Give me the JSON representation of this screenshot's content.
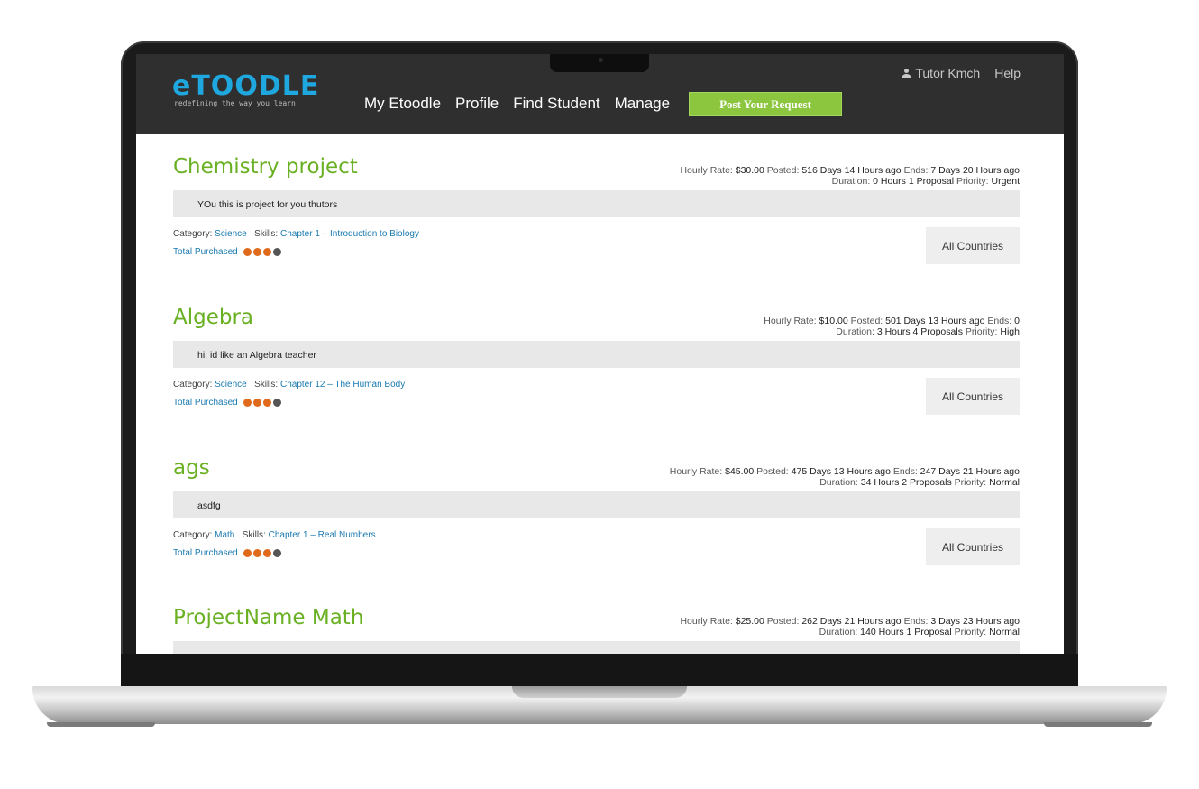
{
  "header": {
    "logo_text": "eTOODLE",
    "tagline": "redefining the way you learn",
    "nav": [
      "My Etoodle",
      "Profile",
      "Find Student",
      "Manage"
    ],
    "post_button": "Post Your Request",
    "user": "Tutor Kmch",
    "help": "Help"
  },
  "projects": [
    {
      "title": "Chemistry project",
      "rate_label": "Hourly Rate:",
      "rate": "$30.00",
      "posted_label": "Posted:",
      "posted": "516 Days 14 Hours ago",
      "ends_label": "Ends:",
      "ends": "7 Days 20 Hours ago",
      "duration_label": "Duration:",
      "duration": "0 Hours 1 Proposal",
      "priority_label": "Priority:",
      "priority": "Urgent",
      "description": "YOu this is project for you thutors",
      "category_label": "Category:",
      "category": "Science",
      "skills_label": "Skills:",
      "skills": "Chapter 1 – Introduction to Biology",
      "purchased_label": "Total Purchased",
      "countries": "All Countries"
    },
    {
      "title": "Algebra",
      "rate_label": "Hourly Rate:",
      "rate": "$10.00",
      "posted_label": "Posted:",
      "posted": "501 Days 13 Hours ago",
      "ends_label": "Ends:",
      "ends": "0",
      "duration_label": "Duration:",
      "duration": "3 Hours 4 Proposals",
      "priority_label": "Priority:",
      "priority": "High",
      "description": "hi, id like an Algebra teacher",
      "category_label": "Category:",
      "category": "Science",
      "skills_label": "Skills:",
      "skills": "Chapter 12 – The Human Body",
      "purchased_label": "Total Purchased",
      "countries": "All Countries"
    },
    {
      "title": "ags",
      "rate_label": "Hourly Rate:",
      "rate": "$45.00",
      "posted_label": "Posted:",
      "posted": "475 Days 13 Hours ago",
      "ends_label": "Ends:",
      "ends": "247 Days 21 Hours ago",
      "duration_label": "Duration:",
      "duration": "34 Hours 2 Proposals",
      "priority_label": "Priority:",
      "priority": "Normal",
      "description": "asdfg",
      "category_label": "Category:",
      "category": "Math",
      "skills_label": "Skills:",
      "skills": "Chapter 1 – Real Numbers",
      "purchased_label": "Total Purchased",
      "countries": "All Countries"
    },
    {
      "title": "ProjectName Math",
      "rate_label": "Hourly Rate:",
      "rate": "$25.00",
      "posted_label": "Posted:",
      "posted": "262 Days 21 Hours ago",
      "ends_label": "Ends:",
      "ends": "3 Days 23 Hours ago",
      "duration_label": "Duration:",
      "duration": "140 Hours 1 Proposal",
      "priority_label": "Priority:",
      "priority": "Normal"
    }
  ],
  "colors": {
    "header_bg": "#2f2f2f",
    "accent_green": "#8cc63f",
    "title_green": "#6ab023",
    "link_blue": "#1a7ab0",
    "dot_orange": "#e06a1b"
  }
}
